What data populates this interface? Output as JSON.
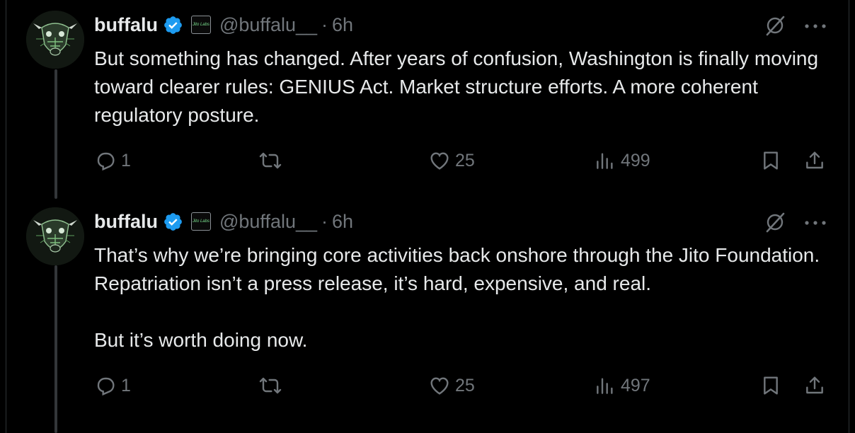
{
  "colors": {
    "background": "#000000",
    "text": "#e7e9ea",
    "muted": "#71767b",
    "verified": "#1d9bf0",
    "thread_line": "#333639"
  },
  "tweets": [
    {
      "author": {
        "name": "buffalu",
        "handle": "@buffalu__",
        "verified": true,
        "affiliate_badge": "Jito Labs"
      },
      "time": "6h",
      "separator": "·",
      "text": "But something has changed. After years of confusion, Washington is finally moving toward clearer rules: GENIUS Act. Market structure efforts. A more coherent regulatory posture.",
      "actions": {
        "replies": "1",
        "reposts": "",
        "likes": "25",
        "views": "499"
      },
      "icons": [
        "grok-icon",
        "more-icon",
        "reply-icon",
        "repost-icon",
        "like-icon",
        "views-icon",
        "bookmark-icon",
        "share-icon"
      ]
    },
    {
      "author": {
        "name": "buffalu",
        "handle": "@buffalu__",
        "verified": true,
        "affiliate_badge": "Jito Labs"
      },
      "time": "6h",
      "separator": "·",
      "text": "That’s why we’re bringing core activities back onshore through the Jito Foundation. Repatriation isn’t a press release, it’s hard, expensive, and real.\n\nBut it’s worth doing now.",
      "actions": {
        "replies": "1",
        "reposts": "",
        "likes": "25",
        "views": "497"
      },
      "icons": [
        "grok-icon",
        "more-icon",
        "reply-icon",
        "repost-icon",
        "like-icon",
        "views-icon",
        "bookmark-icon",
        "share-icon"
      ]
    }
  ]
}
